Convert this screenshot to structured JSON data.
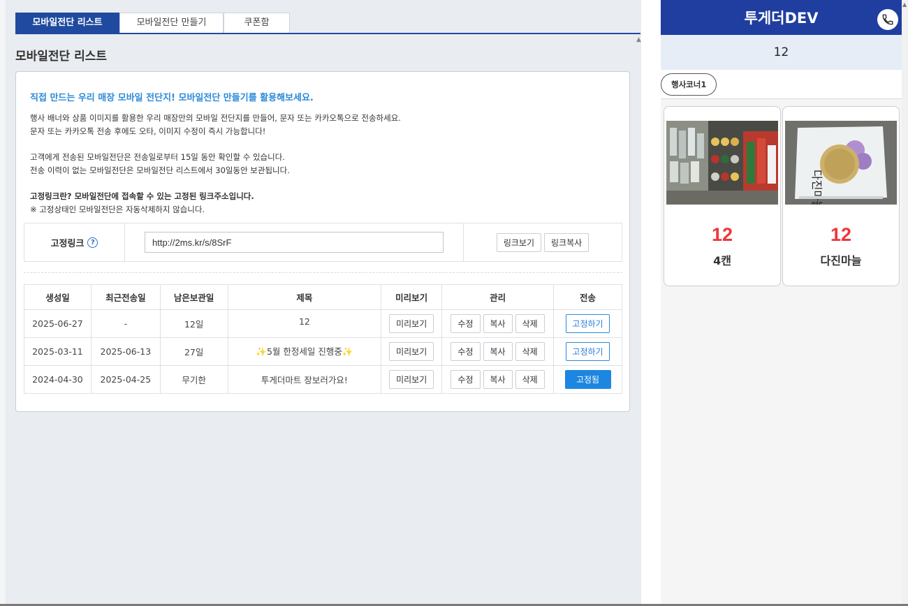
{
  "tabs": [
    {
      "label": "모바일전단 리스트",
      "active": true
    },
    {
      "label": "모바일전단 만들기",
      "active": false
    },
    {
      "label": "쿠폰함",
      "active": false
    }
  ],
  "page_title": "모바일전단 리스트",
  "intro": {
    "headline": "직접 만드는 우리 매장 모바일 전단지! 모바일전단 만들기를 활용해보세요.",
    "line1": "행사 배너와 상품 이미지를 활용한 우리 매장만의 모바일 전단지를 만들어, 문자 또는 카카오톡으로 전송하세요.",
    "line2": "문자 또는 카카오톡 전송 후에도 오타, 이미지 수정이 즉시 가능합니다!",
    "line3": "고객에게 전송된 모바일전단은 전송일로부터 15일 동안 확인할 수 있습니다.",
    "line4": "전송 이력이 없는 모바일전단은 모바일전단 리스트에서 30일동안 보관됩니다.",
    "line5": "고정링크란? 모바일전단에 접속할 수 있는 고정된 링크주소입니다.",
    "line6": "※ 고정상태인 모바일전단은 자동삭제하지 않습니다."
  },
  "fixed_link": {
    "label": "고정링크",
    "help_icon": "?",
    "url": "http://2ms.kr/s/8SrF",
    "view_label": "링크보기",
    "copy_label": "링크복사"
  },
  "table": {
    "headers": [
      "생성일",
      "최근전송일",
      "남은보관일",
      "제목",
      "미리보기",
      "관리",
      "전송"
    ],
    "preview_label": "미리보기",
    "edit_label": "수정",
    "copy_label": "복사",
    "delete_label": "삭제",
    "rows": [
      {
        "created": "2025-06-27",
        "last_sent": "-",
        "remaining": "12일",
        "title": "12",
        "send_label": "고정하기",
        "fixed": false
      },
      {
        "created": "2025-03-11",
        "last_sent": "2025-06-13",
        "remaining": "27일",
        "title_prefix": "✨",
        "title": "5월 한정세일 진행중",
        "title_suffix": "✨",
        "send_label": "고정하기",
        "fixed": false
      },
      {
        "created": "2024-04-30",
        "last_sent": "2025-04-25",
        "remaining": "무기한",
        "title": "투게더마트 장보러가요!",
        "send_label": "고정됨",
        "fixed": true
      }
    ]
  },
  "preview": {
    "store_name": "투게더DEV",
    "subtitle": "12",
    "category": "행사코너1",
    "products": [
      {
        "price": "12",
        "name": "4캔"
      },
      {
        "price": "12",
        "name": "다진마늘"
      }
    ]
  },
  "colors": {
    "primary": "#1f4aa0",
    "accent_blue": "#2c8ad8",
    "price_red": "#f0353b"
  }
}
